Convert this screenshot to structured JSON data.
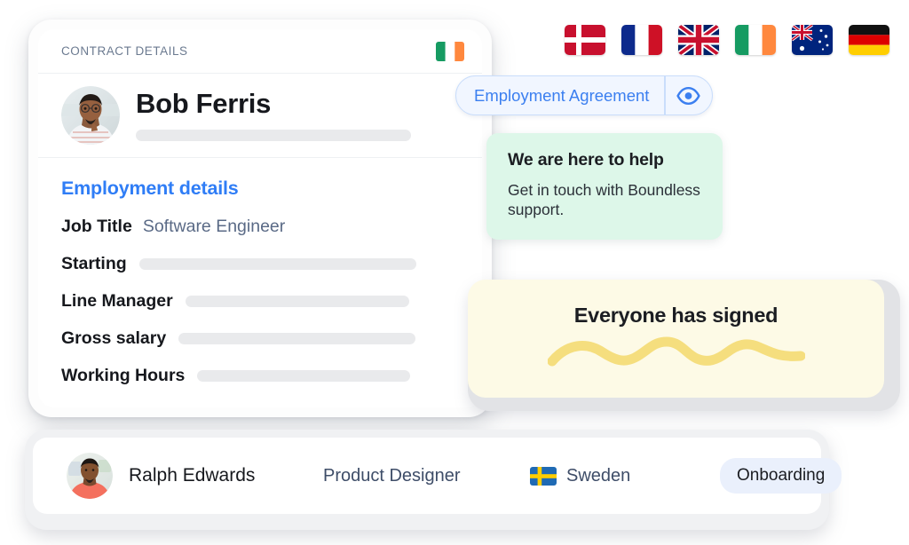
{
  "flags_row": {
    "name": "country-flags",
    "items": [
      {
        "code": "dk",
        "label": "Denmark"
      },
      {
        "code": "fr",
        "label": "France"
      },
      {
        "code": "gb",
        "label": "United Kingdom"
      },
      {
        "code": "ie",
        "label": "Ireland"
      },
      {
        "code": "au",
        "label": "Australia"
      },
      {
        "code": "de",
        "label": "Germany"
      }
    ]
  },
  "contract_card": {
    "header_title": "CONTRACT DETAILS",
    "header_flag": {
      "code": "ie",
      "label": "Ireland"
    },
    "person": {
      "name": "Bob Ferris",
      "avatar_alt": "Bob Ferris avatar"
    },
    "details": {
      "section_title": "Employment details",
      "rows": [
        {
          "label": "Job Title",
          "value": "Software Engineer",
          "placeholder": false
        },
        {
          "label": "Starting",
          "value": "",
          "placeholder": true
        },
        {
          "label": "Line Manager",
          "value": "",
          "placeholder": true
        },
        {
          "label": "Gross salary",
          "value": "",
          "placeholder": true
        },
        {
          "label": "Working Hours",
          "value": "",
          "placeholder": true
        }
      ]
    }
  },
  "agreement_pill": {
    "label": "Employment Agreement",
    "icon": "eye-icon"
  },
  "help_card": {
    "title": "We are here to help",
    "body": "Get in touch with Boundless support."
  },
  "signed_card": {
    "title": "Everyone has signed",
    "signature": "squiggle-signature"
  },
  "employee_row": {
    "name": "Ralph Edwards",
    "role": "Product Designer",
    "country": "Sweden",
    "country_flag": {
      "code": "se",
      "label": "Sweden"
    },
    "status": "Onboarding"
  },
  "colors": {
    "accent_blue": "#2f7df6",
    "pill_blue": "#3b7ff0",
    "pill_bg": "#f1f6ff",
    "help_green": "#ddf7e9",
    "signed_yellow": "#fdfae6",
    "squiggle_yellow": "#f5de7e",
    "badge_bg": "#eaf0fc",
    "skeleton_gray": "#e9eaec",
    "text_dark": "#16181d",
    "text_muted": "#5a6a86"
  }
}
